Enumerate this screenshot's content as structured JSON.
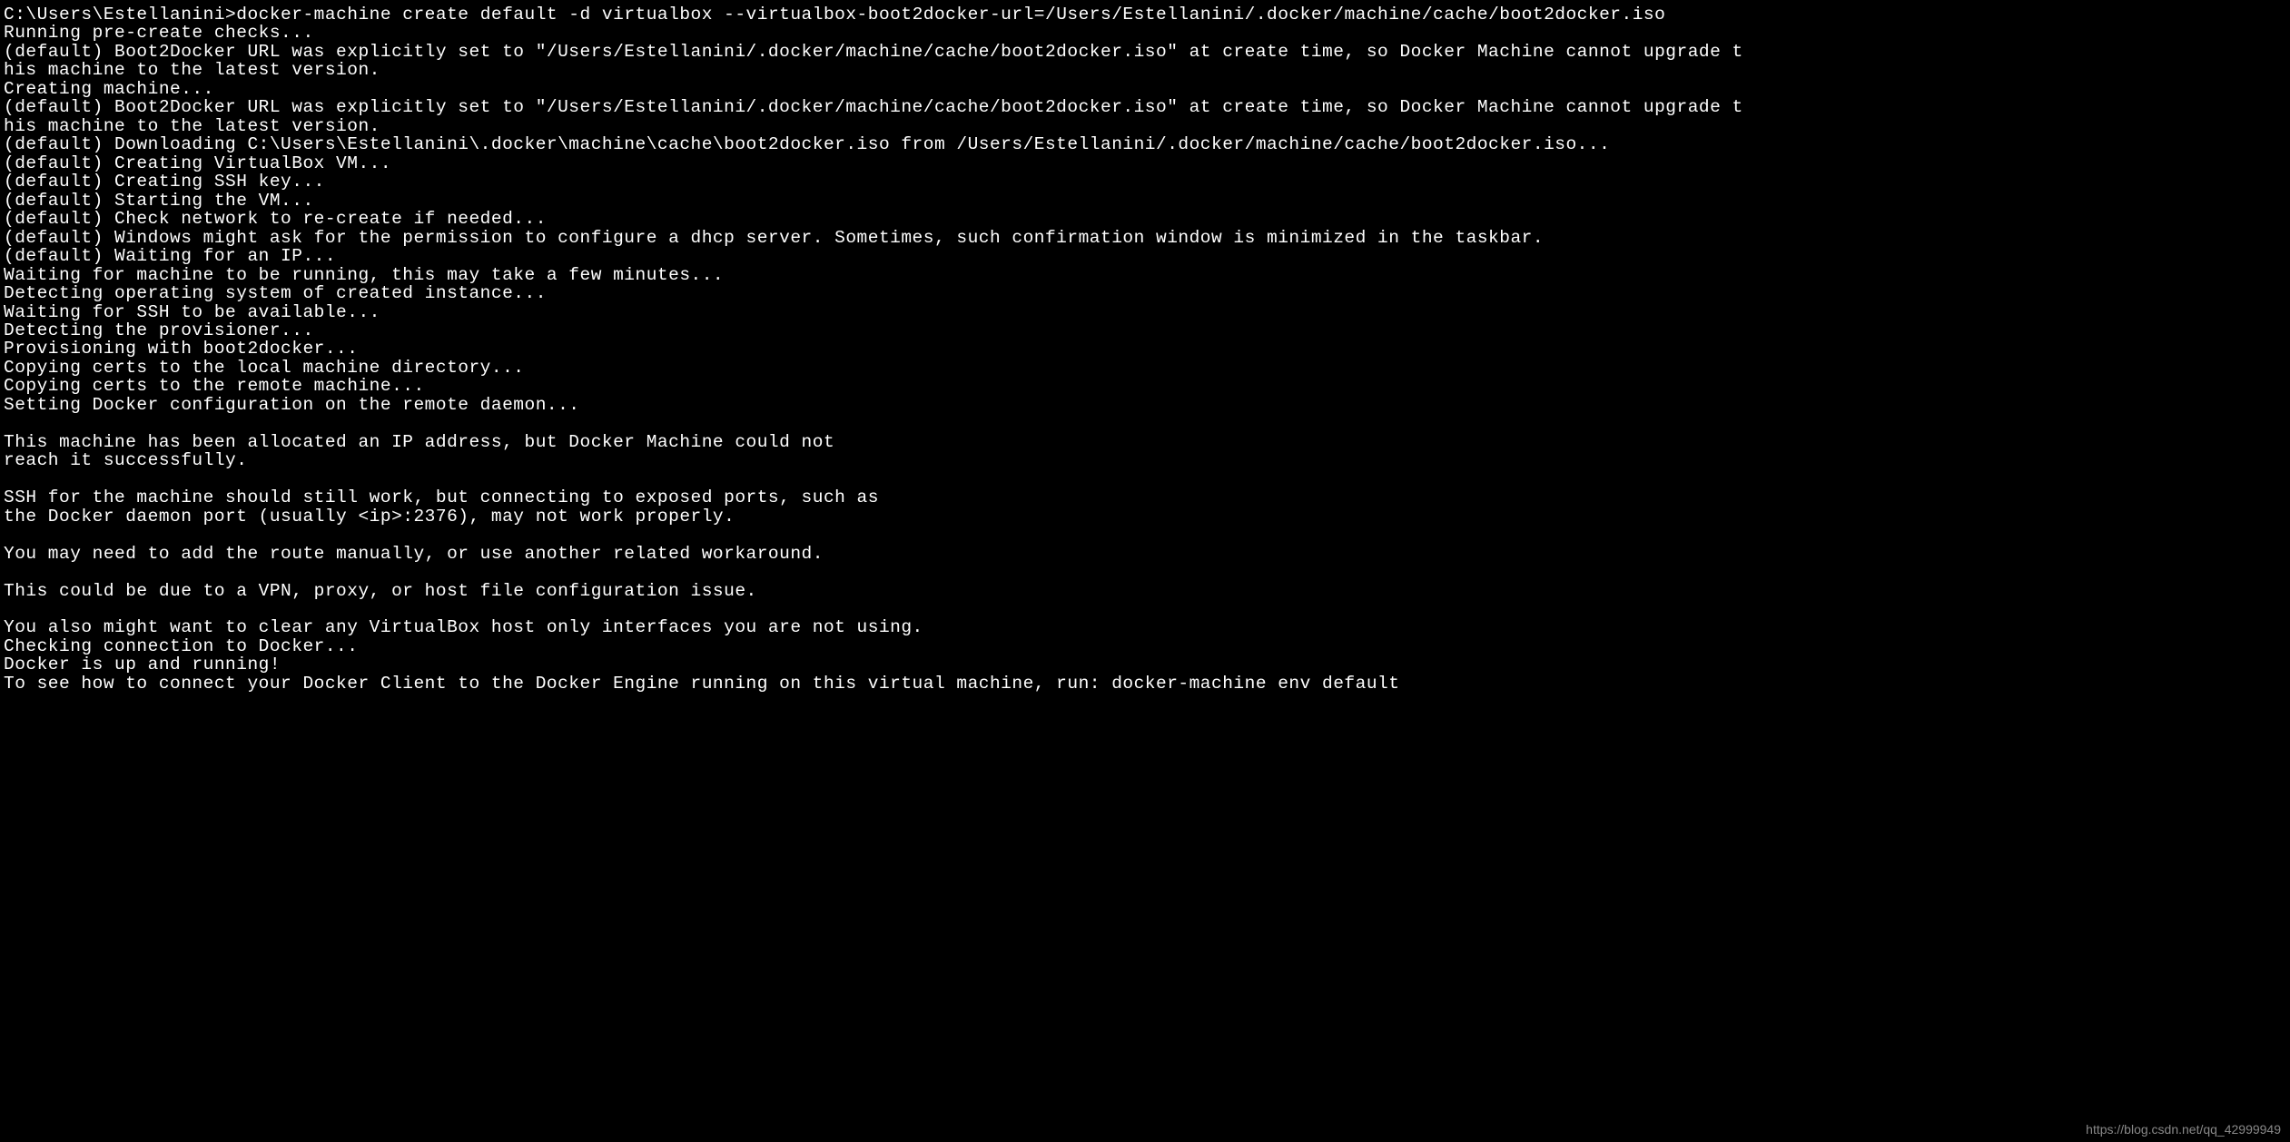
{
  "terminal": {
    "prompt": "C:\\Users\\Estellanini>",
    "command": "docker-machine create default -d virtualbox --virtualbox-boot2docker-url=/Users/Estellanini/.docker/machine/cache/boot2docker.iso",
    "lines": [
      "Running pre-create checks...",
      "(default) Boot2Docker URL was explicitly set to \"/Users/Estellanini/.docker/machine/cache/boot2docker.iso\" at create time, so Docker Machine cannot upgrade t",
      "his machine to the latest version.",
      "Creating machine...",
      "(default) Boot2Docker URL was explicitly set to \"/Users/Estellanini/.docker/machine/cache/boot2docker.iso\" at create time, so Docker Machine cannot upgrade t",
      "his machine to the latest version.",
      "(default) Downloading C:\\Users\\Estellanini\\.docker\\machine\\cache\\boot2docker.iso from /Users/Estellanini/.docker/machine/cache/boot2docker.iso...",
      "(default) Creating VirtualBox VM...",
      "(default) Creating SSH key...",
      "(default) Starting the VM...",
      "(default) Check network to re-create if needed...",
      "(default) Windows might ask for the permission to configure a dhcp server. Sometimes, such confirmation window is minimized in the taskbar.",
      "(default) Waiting for an IP...",
      "Waiting for machine to be running, this may take a few minutes...",
      "Detecting operating system of created instance...",
      "Waiting for SSH to be available...",
      "Detecting the provisioner...",
      "Provisioning with boot2docker...",
      "Copying certs to the local machine directory...",
      "Copying certs to the remote machine...",
      "Setting Docker configuration on the remote daemon...",
      "",
      "This machine has been allocated an IP address, but Docker Machine could not",
      "reach it successfully.",
      "",
      "SSH for the machine should still work, but connecting to exposed ports, such as",
      "the Docker daemon port (usually <ip>:2376), may not work properly.",
      "",
      "You may need to add the route manually, or use another related workaround.",
      "",
      "This could be due to a VPN, proxy, or host file configuration issue.",
      "",
      "You also might want to clear any VirtualBox host only interfaces you are not using.",
      "Checking connection to Docker...",
      "Docker is up and running!",
      "To see how to connect your Docker Client to the Docker Engine running on this virtual machine, run: docker-machine env default"
    ]
  },
  "watermark": "https://blog.csdn.net/qq_42999949"
}
